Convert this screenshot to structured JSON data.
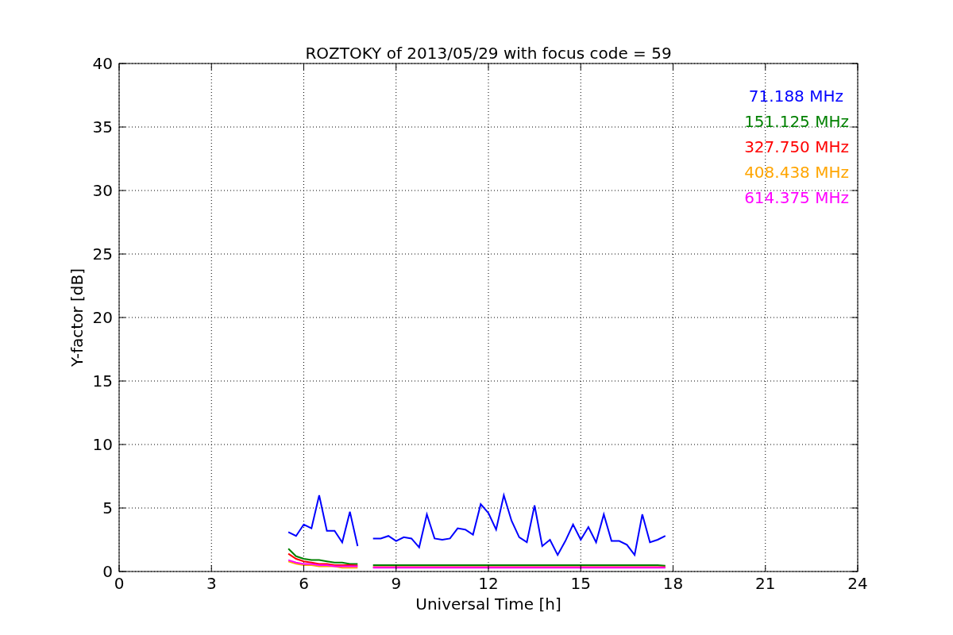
{
  "figure": {
    "chart_data": {
      "type": "line",
      "grid": true,
      "title": "ROZTOKY of 2013/05/29 with focus code = 59",
      "xlabel": "Universal Time [h]",
      "ylabel": "Y-factor [dB]",
      "xlim": [
        0,
        24
      ],
      "ylim": [
        0,
        40
      ],
      "xticks": [
        0,
        3,
        6,
        9,
        12,
        15,
        18,
        21,
        24
      ],
      "yticks": [
        0,
        5,
        10,
        15,
        20,
        25,
        30,
        35,
        40
      ],
      "x": [
        5.5,
        5.75,
        6,
        6.25,
        6.5,
        6.75,
        7,
        7.25,
        7.5,
        7.75,
        8.25,
        8.5,
        8.75,
        9,
        9.25,
        9.5,
        9.75,
        10,
        10.25,
        10.5,
        10.75,
        11,
        11.25,
        11.5,
        11.75,
        12,
        12.25,
        12.5,
        12.75,
        13,
        13.25,
        13.5,
        13.75,
        14,
        14.25,
        14.5,
        14.75,
        15,
        15.25,
        15.5,
        15.75,
        16,
        16.25,
        16.5,
        16.75,
        17,
        17.25,
        17.5,
        17.75
      ],
      "series": [
        {
          "name": "71.188 MHz",
          "color": "#0000ff",
          "values": [
            3.1,
            2.8,
            3.7,
            3.4,
            6.0,
            3.2,
            3.2,
            2.3,
            4.7,
            2.0,
            2.6,
            2.6,
            2.8,
            2.4,
            2.7,
            2.6,
            1.9,
            4.5,
            2.6,
            2.5,
            2.6,
            3.4,
            3.3,
            2.9,
            5.3,
            4.6,
            3.3,
            6.0,
            4.0,
            2.7,
            2.3,
            5.2,
            2.0,
            2.5,
            1.3,
            2.4,
            3.7,
            2.5,
            3.5,
            2.3,
            4.5,
            2.4,
            2.4,
            2.1,
            1.3,
            4.5,
            2.3,
            2.5,
            2.8
          ]
        },
        {
          "name": "151.125 MHz",
          "color": "#008000",
          "values": [
            1.8,
            1.2,
            1.0,
            0.9,
            0.9,
            0.8,
            0.7,
            0.7,
            0.6,
            0.6,
            0.5,
            0.5,
            0.5,
            0.5,
            0.5,
            0.5,
            0.5,
            0.5,
            0.5,
            0.5,
            0.5,
            0.5,
            0.5,
            0.5,
            0.5,
            0.5,
            0.5,
            0.5,
            0.5,
            0.5,
            0.5,
            0.5,
            0.5,
            0.5,
            0.5,
            0.5,
            0.5,
            0.5,
            0.5,
            0.5,
            0.5,
            0.5,
            0.5,
            0.5,
            0.5,
            0.5,
            0.5,
            0.5,
            0.45
          ]
        },
        {
          "name": "327.750 MHz",
          "color": "#ff0000",
          "values": [
            1.4,
            1.0,
            0.8,
            0.7,
            0.6,
            0.6,
            0.5,
            0.5,
            0.5,
            0.47,
            0.35,
            0.35,
            0.35,
            0.35,
            0.35,
            0.35,
            0.35,
            0.35,
            0.35,
            0.35,
            0.35,
            0.35,
            0.35,
            0.35,
            0.35,
            0.35,
            0.35,
            0.35,
            0.35,
            0.35,
            0.35,
            0.35,
            0.35,
            0.35,
            0.35,
            0.35,
            0.35,
            0.35,
            0.35,
            0.35,
            0.35,
            0.35,
            0.35,
            0.35,
            0.35,
            0.35,
            0.35,
            0.35,
            0.35
          ]
        },
        {
          "name": "408.438 MHz",
          "color": "#ffa500",
          "values": [
            0.8,
            0.6,
            0.5,
            0.5,
            0.4,
            0.4,
            0.4,
            0.3,
            0.3,
            0.3,
            null,
            null,
            null,
            null,
            null,
            null,
            null,
            null,
            null,
            null,
            null,
            null,
            null,
            null,
            null,
            null,
            null,
            null,
            null,
            null,
            null,
            null,
            null,
            null,
            null,
            null,
            null,
            null,
            null,
            null,
            null,
            null,
            null,
            null,
            null,
            null,
            null,
            null,
            null
          ]
        },
        {
          "name": "614.375 MHz",
          "color": "#ff00ff",
          "values": [
            0.9,
            0.7,
            0.6,
            0.6,
            0.5,
            0.5,
            0.4,
            0.4,
            0.4,
            0.4,
            0.3,
            0.3,
            0.3,
            0.3,
            0.3,
            0.3,
            0.3,
            0.3,
            0.3,
            0.3,
            0.3,
            0.3,
            0.3,
            0.3,
            0.3,
            0.3,
            0.3,
            0.3,
            0.3,
            0.3,
            0.3,
            0.3,
            0.3,
            0.3,
            0.3,
            0.3,
            0.3,
            0.3,
            0.3,
            0.3,
            0.3,
            0.3,
            0.3,
            0.3,
            0.3,
            0.3,
            0.3,
            0.3,
            0.3
          ]
        }
      ]
    }
  }
}
